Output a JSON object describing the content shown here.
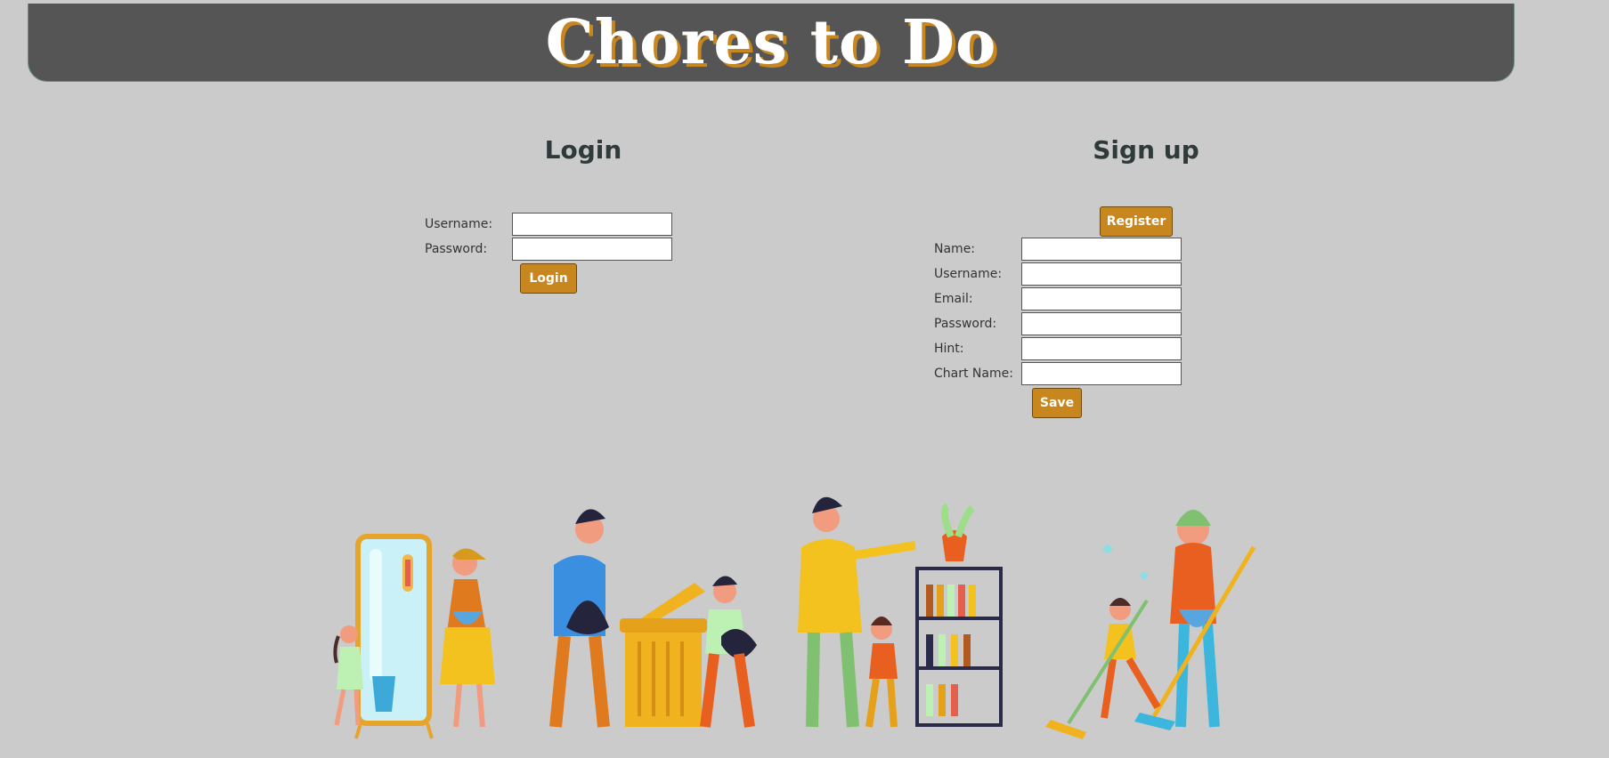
{
  "header": {
    "title": "Chores to Do"
  },
  "login": {
    "title": "Login",
    "username_label": "Username:",
    "password_label": "Password:",
    "username_value": "",
    "password_value": "",
    "button_label": "Login"
  },
  "signup": {
    "title": "Sign up",
    "register_label": "Register",
    "name_label": "Name:",
    "username_label": "Username:",
    "email_label": "Email:",
    "password_label": "Password:",
    "hint_label": "Hint:",
    "chart_name_label": "Chart Name:",
    "save_label": "Save"
  },
  "colors": {
    "background": "#cbcbcb",
    "banner": "#555555",
    "accent": "#c8861f"
  }
}
